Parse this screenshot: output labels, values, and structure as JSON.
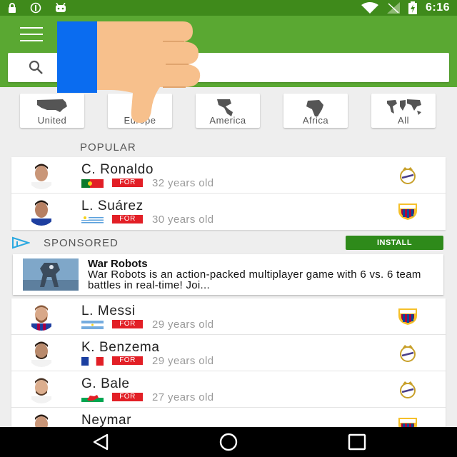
{
  "status_bar": {
    "time": "6:16",
    "icons": [
      "lock-icon",
      "info-icon",
      "android-icon",
      "wifi-icon",
      "no-signal-icon",
      "battery-charging-icon"
    ]
  },
  "app_bar": {
    "menu_icon": "hamburger-menu-icon",
    "search": {
      "placeholder": "",
      "value": ""
    }
  },
  "regions": [
    {
      "label": "United",
      "icon": "usa-map-icon"
    },
    {
      "label": "Europe",
      "icon": "europe-map-icon"
    },
    {
      "label": "America",
      "icon": "americas-map-icon"
    },
    {
      "label": "Africa",
      "icon": "africa-map-icon"
    },
    {
      "label": "All",
      "icon": "world-map-icon"
    }
  ],
  "popular": {
    "title": "POPULAR",
    "players": [
      {
        "name": "C. Ronaldo",
        "position": "FOR",
        "age": "32 years old",
        "flag": "portugal-flag",
        "club": "real-madrid-crest"
      },
      {
        "name": "L. Suárez",
        "position": "FOR",
        "age": "30 years old",
        "flag": "uruguay-flag",
        "club": "fc-barcelona-crest"
      }
    ]
  },
  "sponsored": {
    "label": "SPONSORED",
    "install_label": "INSTALL",
    "ad": {
      "title": "War Robots",
      "description": "War Robots is an action-packed multiplayer game with 6 vs. 6 team battles in real-time! Joi..."
    }
  },
  "more_players": [
    {
      "name": "L. Messi",
      "position": "FOR",
      "age": "29 years old",
      "flag": "argentina-flag",
      "club": "fc-barcelona-crest"
    },
    {
      "name": "K. Benzema",
      "position": "FOR",
      "age": "29 years old",
      "flag": "france-flag",
      "club": "real-madrid-crest"
    },
    {
      "name": "G. Bale",
      "position": "FOR",
      "age": "27 years old",
      "flag": "wales-flag",
      "club": "real-madrid-crest"
    },
    {
      "name": "Neymar",
      "position": "",
      "age": "",
      "flag": "",
      "club": "fc-barcelona-crest"
    }
  ],
  "nav_bar": {
    "icons": [
      "back-icon",
      "home-icon",
      "recents-icon"
    ]
  },
  "colors": {
    "status_bar": "#3f8a1b",
    "app_bar": "#5aa832",
    "install_button": "#2e8a1a",
    "position_badge": "#e21f26",
    "overlay_blue": "#0a6cf0",
    "thumb_skin": "#f7c08c"
  }
}
